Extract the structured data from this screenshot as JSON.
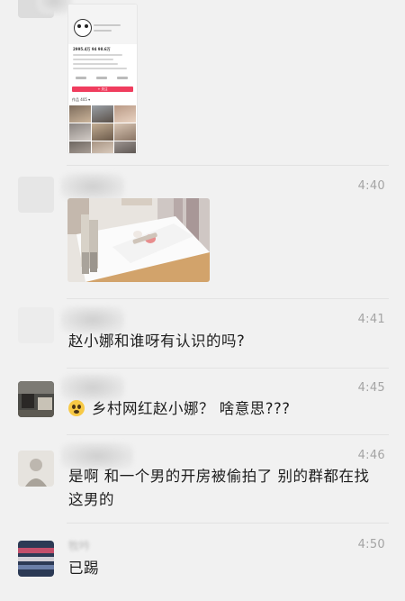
{
  "messages": [
    {
      "time": "",
      "type": "image",
      "image": "profile-screenshot",
      "profile": {
        "stats": "2995.4万  94  98.6万",
        "button": "+ 关注",
        "tab": "作品 405 ▾"
      }
    },
    {
      "time": "4:40",
      "type": "image",
      "image": "bed-photo"
    },
    {
      "time": "4:41",
      "type": "text",
      "text": "赵小娜和谁呀有认识的吗?"
    },
    {
      "time": "4:45",
      "type": "text",
      "emoji": "grinning-face",
      "text": "乡村网红赵小娜？ 啥意思???"
    },
    {
      "time": "4:46",
      "type": "text",
      "lines": [
        "是啊 和一个男的开房被偷拍了 别的群都在找",
        "这男的"
      ]
    },
    {
      "time": "4:50",
      "type": "text",
      "sender": "牧吟",
      "text": "已踢"
    }
  ],
  "colors": {
    "background": "#f1f1f1",
    "time": "#a4a4a4",
    "text": "#1e1e1e",
    "accent": "#f03d5e"
  }
}
